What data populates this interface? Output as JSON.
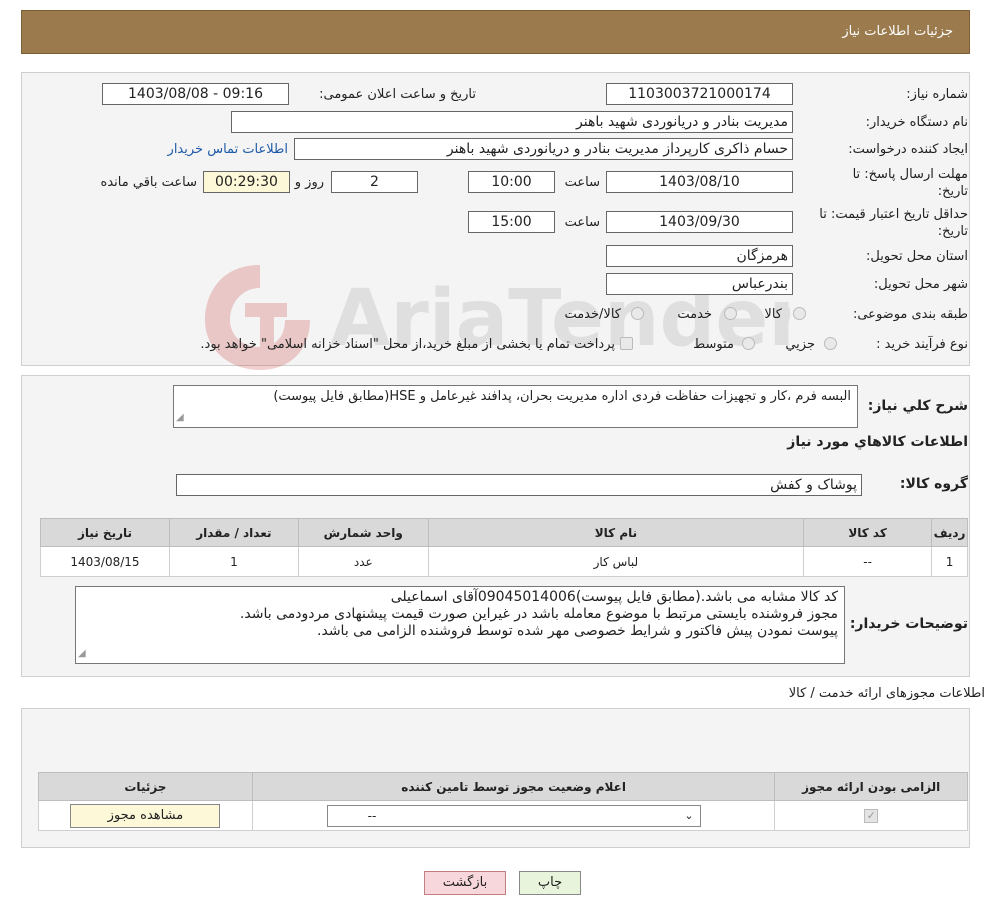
{
  "header": {
    "title": "جزئیات اطلاعات نیاز"
  },
  "need_info": {
    "need_number_label": "شماره نیاز:",
    "need_number": "1103003721000174",
    "announce_label": "تاریخ و ساعت اعلان عمومی:",
    "announce_value": "1403/08/08 - 09:16",
    "buyer_org_label": "نام دستگاه خریدار:",
    "buyer_org": "مدیریت بنادر و دریانوردی شهید باهنر",
    "creator_label": "ایجاد کننده درخواست:",
    "creator": "حسام  ذاکری کارپرداز مدیریت بنادر و دریانوردی شهید باهنر",
    "contact_link": "اطلاعات تماس خریدار",
    "deadline_label": "مهلت ارسال پاسخ: تا تاریخ:",
    "deadline_date": "1403/08/10",
    "time_label": "ساعت",
    "deadline_time": "10:00",
    "days": "2",
    "days_label": "روز و",
    "remaining": "00:29:30",
    "remaining_label": "ساعت باقي مانده",
    "price_validity_label": "حداقل تاریخ اعتبار قیمت: تا تاریخ:",
    "price_validity_date": "1403/09/30",
    "price_validity_time": "15:00",
    "province_label": "استان محل تحویل:",
    "province": "هرمزگان",
    "city_label": "شهر محل تحویل:",
    "city": "بندرعباس",
    "category_label": "طبقه بندی موضوعی:",
    "category_options": [
      "کالا",
      "خدمت",
      "کالا/خدمت"
    ],
    "process_label": "نوع فرآیند خرید :",
    "process_options": [
      "جزیي",
      "متوسط"
    ],
    "process_note": "پرداخت تمام یا بخشی از مبلغ خرید،از محل \"اسناد خزانه اسلامی\" خواهد بود."
  },
  "summary": {
    "label": "شرح کلي نياز:",
    "text": "البسه فرم ،کار و تجهیزات حفاظت فردی اداره مدیریت بحران، پدافند غیرعامل و  HSE(مطابق فایل پیوست)",
    "goods_title": "اطلاعات کالاهاي مورد نياز",
    "goods_group_label": "گروه کالا:",
    "goods_group": "پوشاک و کفش"
  },
  "goods_table": {
    "headers": [
      "رديف",
      "کد کالا",
      "نام کالا",
      "واحد شمارش",
      "تعداد / مقدار",
      "تاریخ نیاز"
    ],
    "rows": [
      [
        "1",
        "--",
        "لباس کار",
        "عدد",
        "1",
        "1403/08/15"
      ]
    ]
  },
  "buyer_notes": {
    "label": "توضيحات خريدار:",
    "lines": [
      "کد کالا مشابه می باشد.(مطابق فایل پیوست)09045014006آقای اسماعیلی",
      "مجوز فروشنده بایستی مرتبط با موضوع معامله باشد در غیراین صورت قیمت پیشنهادی مردودمی باشد.",
      "پیوست نمودن پیش فاکتور و شرایط خصوصی مهر شده توسط فروشنده الزامی می باشد."
    ]
  },
  "permits": {
    "title": "اطلاعات مجوزهای ارائه خدمت / کالا",
    "headers": [
      "الزامی بودن ارائه مجوز",
      "اعلام وضعیت مجوز توسط تامین کننده",
      "جزئیات"
    ],
    "select_value": "--",
    "view_button": "مشاهده مجوز"
  },
  "actions": {
    "print": "چاپ",
    "back": "بازگشت"
  },
  "watermark": "AriaTender.neT",
  "colors": {
    "header": "#9b7a4d",
    "back_button": "#f8d7dc",
    "print_button": "#e8f5dc",
    "link": "#1e5aa8"
  }
}
